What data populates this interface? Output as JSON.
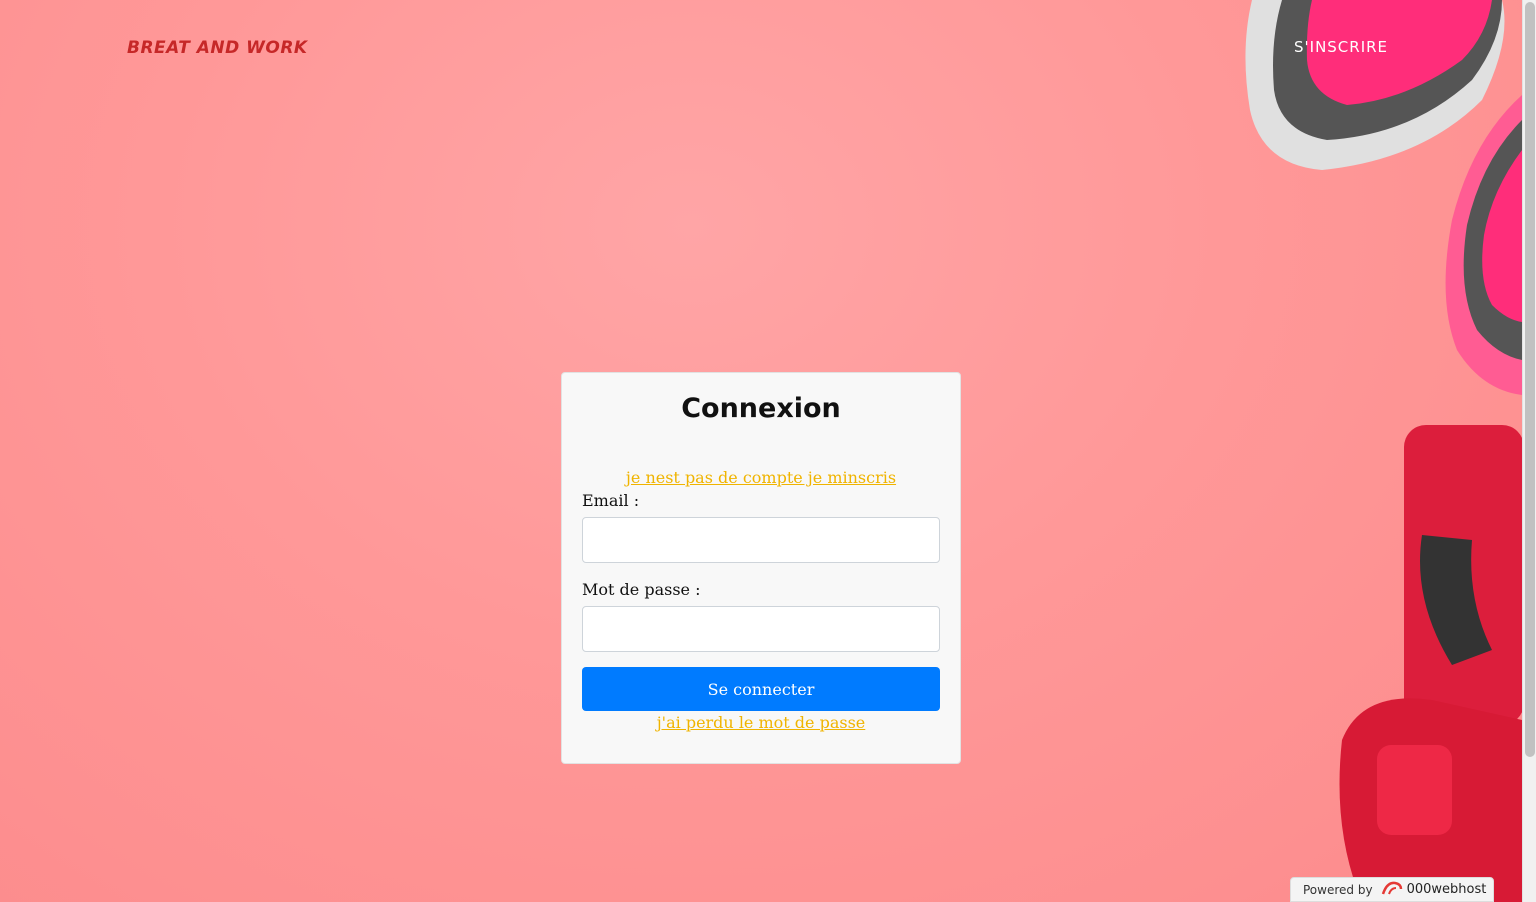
{
  "header": {
    "brand": "BREAT AND WORK",
    "signup_label": "S'INSCRIRE"
  },
  "login": {
    "title": "Connexion",
    "signup_link": "je nest pas de compte je minscris",
    "email_label": "Email :",
    "email_value": "",
    "password_label": "Mot de passe :",
    "password_value": "",
    "submit_label": "Se connecter",
    "lost_password_link": "j'ai perdu le mot de passe"
  },
  "footer": {
    "powered_by": "Powered by",
    "host": "000webhost"
  },
  "colors": {
    "background": "#ff9898",
    "brand": "#c62828",
    "link": "#f0b400",
    "button": "#007bff"
  }
}
